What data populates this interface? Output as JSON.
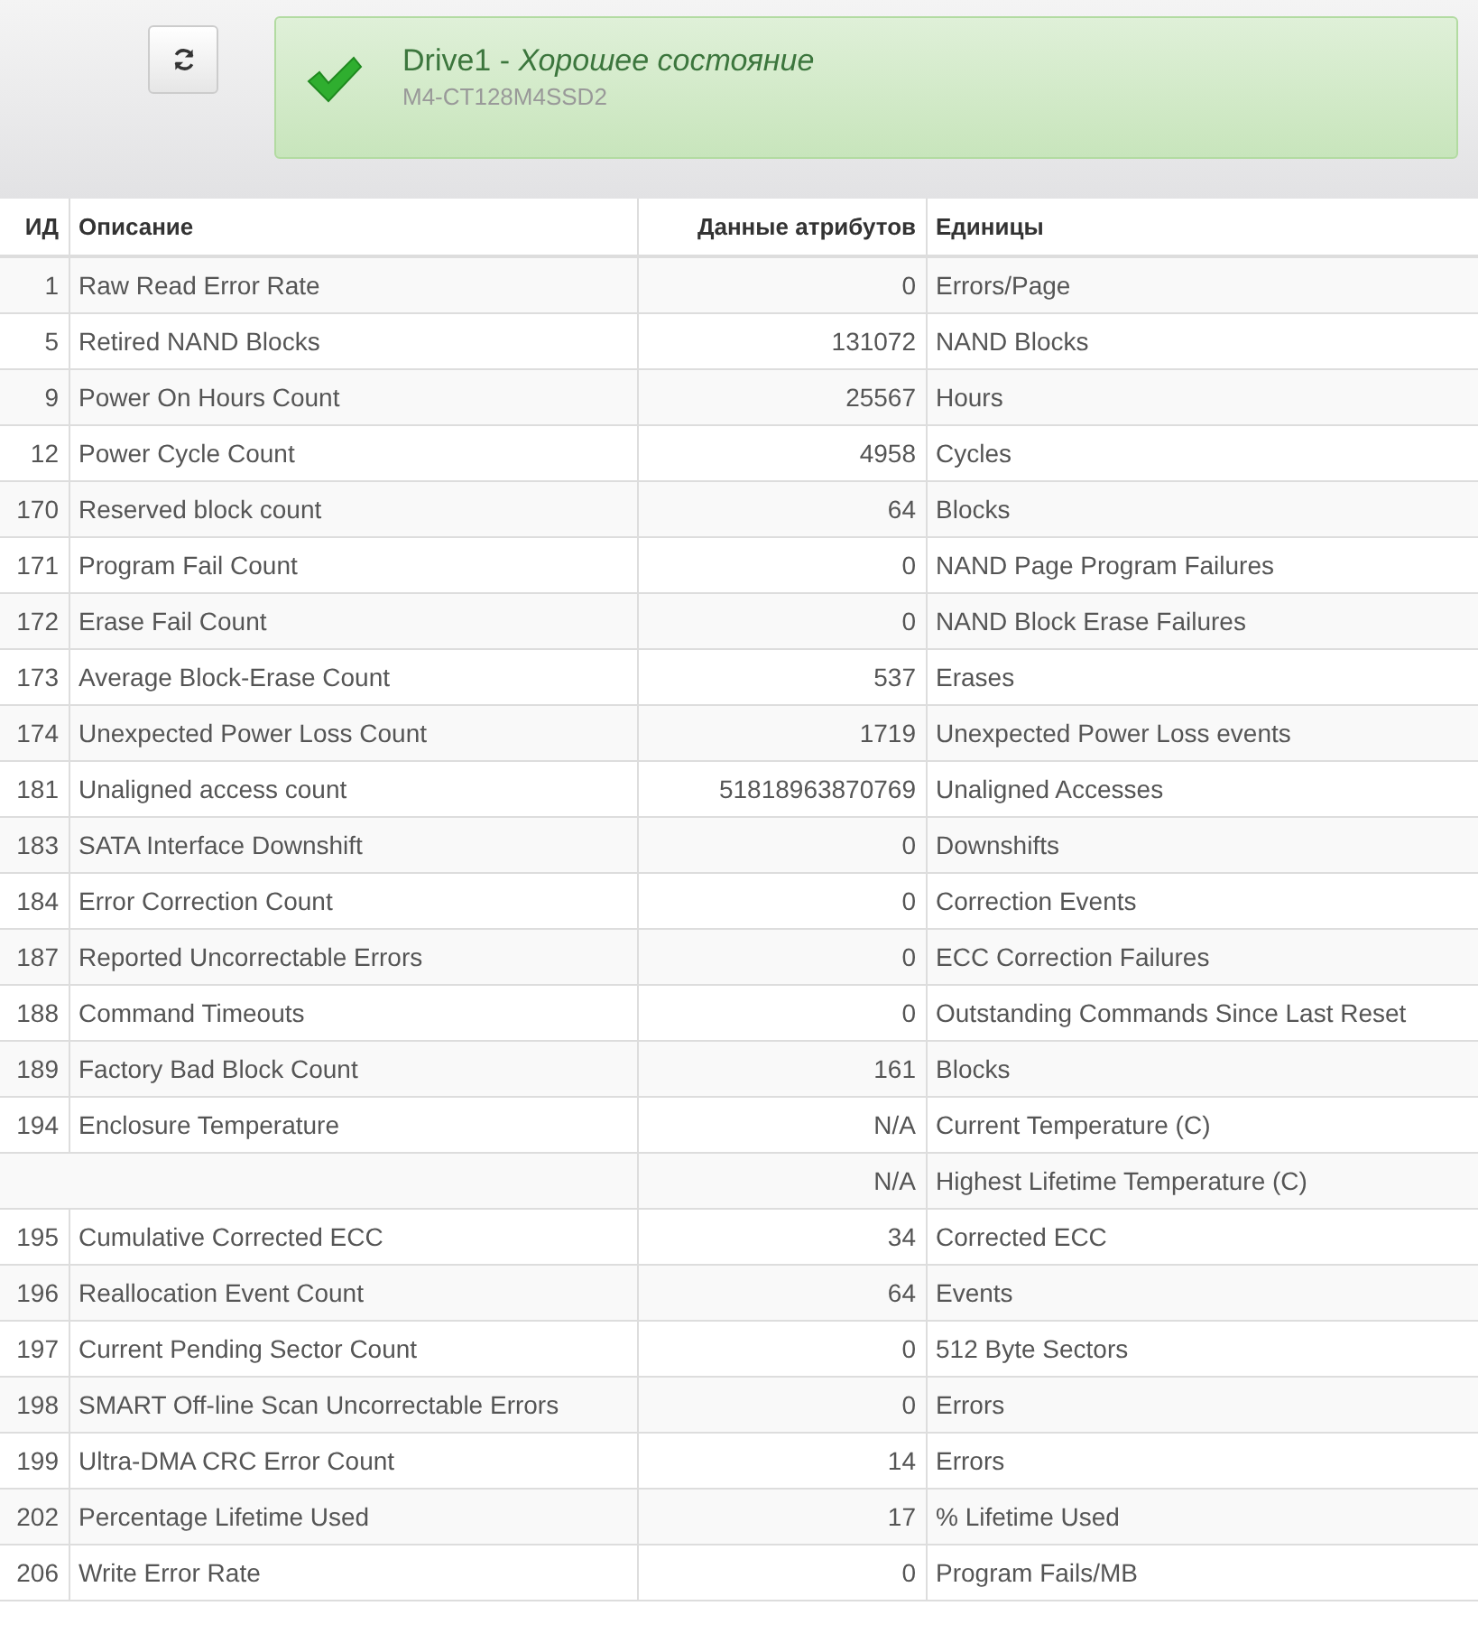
{
  "status": {
    "drive": "Drive1",
    "separator": " - ",
    "state": "Хорошее состояние",
    "model": "M4-CT128M4SSD2",
    "healthy": true
  },
  "table": {
    "columns": [
      "ИД",
      "Описание",
      "Данные атрибутов",
      "Единицы"
    ],
    "rows": [
      {
        "id": "1",
        "description": "Raw Read Error Rate",
        "value": "0",
        "units": "Errors/Page"
      },
      {
        "id": "5",
        "description": "Retired NAND Blocks",
        "value": "131072",
        "units": "NAND Blocks"
      },
      {
        "id": "9",
        "description": "Power On Hours Count",
        "value": "25567",
        "units": "Hours"
      },
      {
        "id": "12",
        "description": "Power Cycle Count",
        "value": "4958",
        "units": "Cycles"
      },
      {
        "id": "170",
        "description": "Reserved block count",
        "value": "64",
        "units": "Blocks"
      },
      {
        "id": "171",
        "description": "Program Fail Count",
        "value": "0",
        "units": "NAND Page Program Failures"
      },
      {
        "id": "172",
        "description": "Erase Fail Count",
        "value": "0",
        "units": "NAND Block Erase Failures"
      },
      {
        "id": "173",
        "description": "Average Block-Erase Count",
        "value": "537",
        "units": "Erases"
      },
      {
        "id": "174",
        "description": "Unexpected Power Loss Count",
        "value": "1719",
        "units": "Unexpected Power Loss events"
      },
      {
        "id": "181",
        "description": "Unaligned access count",
        "value": "51818963870769",
        "units": "Unaligned Accesses"
      },
      {
        "id": "183",
        "description": "SATA Interface Downshift",
        "value": "0",
        "units": "Downshifts"
      },
      {
        "id": "184",
        "description": "Error Correction Count",
        "value": "0",
        "units": "Correction Events"
      },
      {
        "id": "187",
        "description": "Reported Uncorrectable Errors",
        "value": "0",
        "units": "ECC Correction Failures"
      },
      {
        "id": "188",
        "description": "Command Timeouts",
        "value": "0",
        "units": "Outstanding Commands Since Last Reset"
      },
      {
        "id": "189",
        "description": "Factory Bad Block Count",
        "value": "161",
        "units": "Blocks"
      },
      {
        "id": "194",
        "description": "Enclosure Temperature",
        "value": "N/A",
        "units": "Current Temperature (C)"
      },
      {
        "value": "N/A",
        "units": "Highest Lifetime Temperature (C)"
      },
      {
        "id": "195",
        "description": "Cumulative Corrected ECC",
        "value": "34",
        "units": "Corrected ECC"
      },
      {
        "id": "196",
        "description": "Reallocation Event Count",
        "value": "64",
        "units": "Events"
      },
      {
        "id": "197",
        "description": "Current Pending Sector Count",
        "value": "0",
        "units": "512 Byte Sectors"
      },
      {
        "id": "198",
        "description": "SMART Off-line Scan Uncorrectable Errors",
        "value": "0",
        "units": "Errors"
      },
      {
        "id": "199",
        "description": "Ultra-DMA CRC Error Count",
        "value": "14",
        "units": "Errors"
      },
      {
        "id": "202",
        "description": "Percentage Lifetime Used",
        "value": "17",
        "units": "% Lifetime Used"
      },
      {
        "id": "206",
        "description": "Write Error Rate",
        "value": "0",
        "units": "Program Fails/MB"
      }
    ]
  }
}
